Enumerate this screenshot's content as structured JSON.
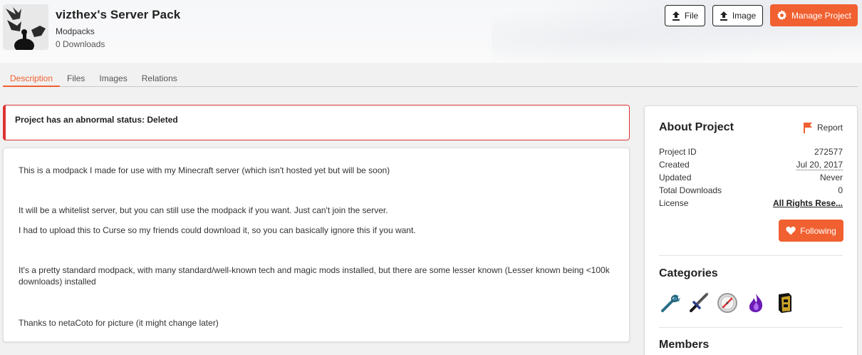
{
  "project": {
    "title": "vizthex's Server Pack",
    "category": "Modpacks",
    "downloads": "0 Downloads"
  },
  "actions": {
    "file_label": "File",
    "image_label": "Image",
    "manage_label": "Manage Project"
  },
  "tabs": [
    {
      "label": "Description",
      "active": true
    },
    {
      "label": "Files"
    },
    {
      "label": "Images"
    },
    {
      "label": "Relations"
    }
  ],
  "alert": {
    "text": "Project has an abnormal status: Deleted"
  },
  "description": {
    "paragraphs": [
      "This is a modpack I made for use with my Minecraft server (which isn't hosted yet but will be soon)",
      "It will be a whitelist server, but you can still use the modpack if you want. Just can't join the server.",
      "I had to upload this to Curse so my friends could download it, so you can basically ignore this if you want.",
      "It's a pretty standard modpack, with many standard/well-known tech and magic mods installed, but there are some lesser known (Lesser known being <100k downloads) installed",
      "Thanks to netaCoto for picture (it might change later)"
    ]
  },
  "about": {
    "heading": "About Project",
    "report_label": "Report",
    "rows": [
      {
        "label": "Project ID",
        "value": "272577"
      },
      {
        "label": "Created",
        "value": "Jul 20, 2017"
      },
      {
        "label": "Updated",
        "value": "Never"
      },
      {
        "label": "Total Downloads",
        "value": "0"
      },
      {
        "label": "License",
        "value": "All Rights Rese..."
      }
    ],
    "follow_label": "Following"
  },
  "categories": {
    "heading": "Categories",
    "icons": [
      "wrench-icon",
      "sword-icon",
      "compass-icon",
      "magic-flame-icon",
      "server-block-icon"
    ]
  },
  "members": {
    "heading": "Members"
  },
  "colors": {
    "accent": "#f06030",
    "alert": "#dd3333"
  }
}
